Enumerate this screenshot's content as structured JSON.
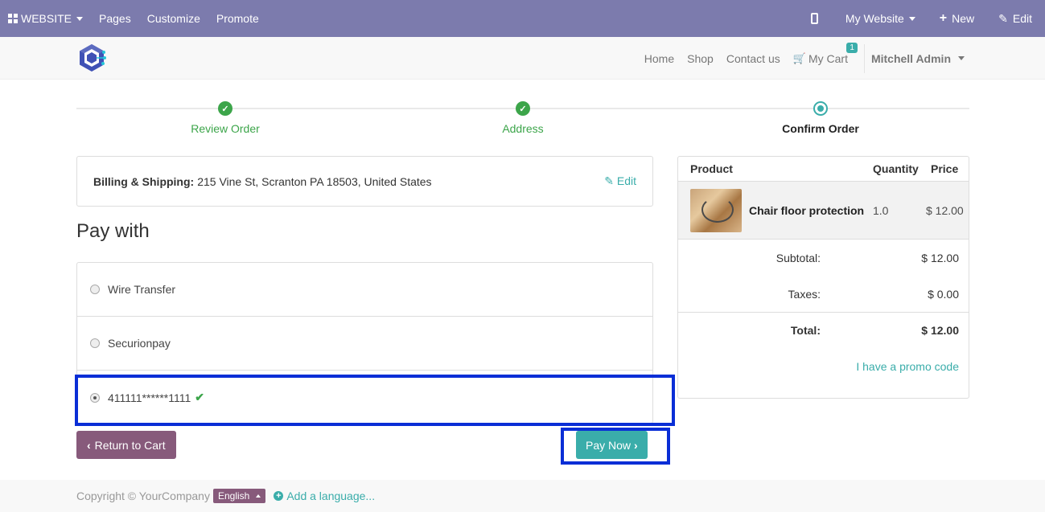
{
  "adminbar": {
    "website_label": "WEBSITE",
    "pages_label": "Pages",
    "customize_label": "Customize",
    "promote_label": "Promote",
    "mywebsite_label": "My Website",
    "new_label": "New",
    "edit_label": "Edit"
  },
  "nav": {
    "items": [
      "Home",
      "Shop",
      "Contact us"
    ],
    "cart_label": "My Cart",
    "cart_count": "1",
    "user_name": "Mitchell Admin"
  },
  "progress": {
    "steps": [
      {
        "label": "Review Order",
        "state": "done"
      },
      {
        "label": "Address",
        "state": "done"
      },
      {
        "label": "Confirm Order",
        "state": "current"
      }
    ]
  },
  "billing": {
    "label": "Billing & Shipping:",
    "address": "215 Vine St, Scranton PA 18503, United States",
    "edit_label": "Edit"
  },
  "payment": {
    "title": "Pay with",
    "methods": [
      {
        "label": "Wire Transfer",
        "selected": false
      },
      {
        "label": "Securionpay",
        "selected": false
      },
      {
        "label": "411111******1111",
        "selected": true
      }
    ],
    "back_label": "Return to Cart",
    "pay_label": "Pay Now"
  },
  "summary": {
    "headers": [
      "Product",
      "Quantity",
      "Price"
    ],
    "product": {
      "name": "Chair floor protection",
      "qty": "1.0",
      "price": "$ 12.00"
    },
    "subtotal_label": "Subtotal:",
    "subtotal_value": "$ 12.00",
    "taxes_label": "Taxes:",
    "taxes_value": "$ 0.00",
    "total_label": "Total:",
    "total_value": "$ 12.00",
    "promo_label": "I have a promo code"
  },
  "footer": {
    "copyright": "Copyright © YourCompany",
    "language": "English",
    "add_language": "Add a language..."
  },
  "colors": {
    "adminbar": "#7c7bad",
    "accent": "#3aadaa",
    "secondary": "#875a7b",
    "success": "#3ca54a",
    "highlight": "#0a2ed6"
  }
}
